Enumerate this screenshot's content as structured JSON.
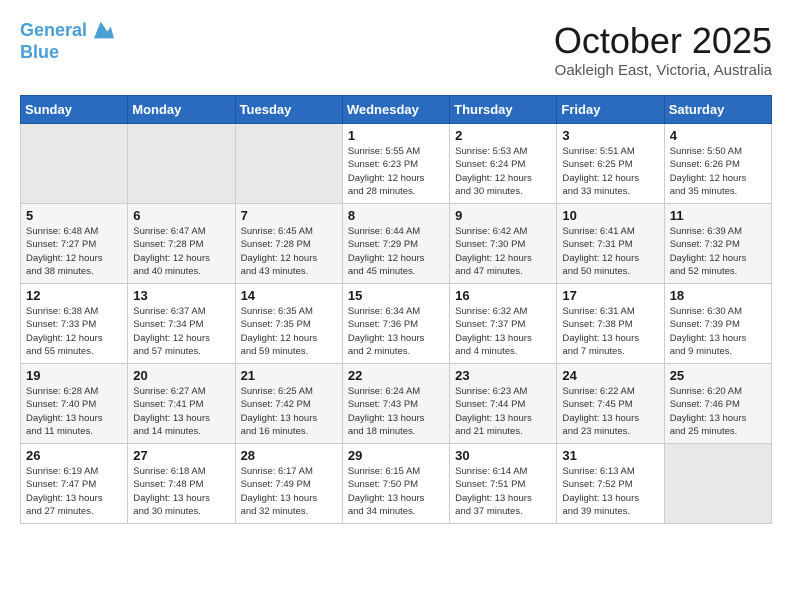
{
  "header": {
    "logo_line1": "General",
    "logo_line2": "Blue",
    "month": "October 2025",
    "location": "Oakleigh East, Victoria, Australia"
  },
  "weekdays": [
    "Sunday",
    "Monday",
    "Tuesday",
    "Wednesday",
    "Thursday",
    "Friday",
    "Saturday"
  ],
  "weeks": [
    [
      {
        "day": "",
        "info": ""
      },
      {
        "day": "",
        "info": ""
      },
      {
        "day": "",
        "info": ""
      },
      {
        "day": "1",
        "info": "Sunrise: 5:55 AM\nSunset: 6:23 PM\nDaylight: 12 hours\nand 28 minutes."
      },
      {
        "day": "2",
        "info": "Sunrise: 5:53 AM\nSunset: 6:24 PM\nDaylight: 12 hours\nand 30 minutes."
      },
      {
        "day": "3",
        "info": "Sunrise: 5:51 AM\nSunset: 6:25 PM\nDaylight: 12 hours\nand 33 minutes."
      },
      {
        "day": "4",
        "info": "Sunrise: 5:50 AM\nSunset: 6:26 PM\nDaylight: 12 hours\nand 35 minutes."
      }
    ],
    [
      {
        "day": "5",
        "info": "Sunrise: 6:48 AM\nSunset: 7:27 PM\nDaylight: 12 hours\nand 38 minutes."
      },
      {
        "day": "6",
        "info": "Sunrise: 6:47 AM\nSunset: 7:28 PM\nDaylight: 12 hours\nand 40 minutes."
      },
      {
        "day": "7",
        "info": "Sunrise: 6:45 AM\nSunset: 7:28 PM\nDaylight: 12 hours\nand 43 minutes."
      },
      {
        "day": "8",
        "info": "Sunrise: 6:44 AM\nSunset: 7:29 PM\nDaylight: 12 hours\nand 45 minutes."
      },
      {
        "day": "9",
        "info": "Sunrise: 6:42 AM\nSunset: 7:30 PM\nDaylight: 12 hours\nand 47 minutes."
      },
      {
        "day": "10",
        "info": "Sunrise: 6:41 AM\nSunset: 7:31 PM\nDaylight: 12 hours\nand 50 minutes."
      },
      {
        "day": "11",
        "info": "Sunrise: 6:39 AM\nSunset: 7:32 PM\nDaylight: 12 hours\nand 52 minutes."
      }
    ],
    [
      {
        "day": "12",
        "info": "Sunrise: 6:38 AM\nSunset: 7:33 PM\nDaylight: 12 hours\nand 55 minutes."
      },
      {
        "day": "13",
        "info": "Sunrise: 6:37 AM\nSunset: 7:34 PM\nDaylight: 12 hours\nand 57 minutes."
      },
      {
        "day": "14",
        "info": "Sunrise: 6:35 AM\nSunset: 7:35 PM\nDaylight: 12 hours\nand 59 minutes."
      },
      {
        "day": "15",
        "info": "Sunrise: 6:34 AM\nSunset: 7:36 PM\nDaylight: 13 hours\nand 2 minutes."
      },
      {
        "day": "16",
        "info": "Sunrise: 6:32 AM\nSunset: 7:37 PM\nDaylight: 13 hours\nand 4 minutes."
      },
      {
        "day": "17",
        "info": "Sunrise: 6:31 AM\nSunset: 7:38 PM\nDaylight: 13 hours\nand 7 minutes."
      },
      {
        "day": "18",
        "info": "Sunrise: 6:30 AM\nSunset: 7:39 PM\nDaylight: 13 hours\nand 9 minutes."
      }
    ],
    [
      {
        "day": "19",
        "info": "Sunrise: 6:28 AM\nSunset: 7:40 PM\nDaylight: 13 hours\nand 11 minutes."
      },
      {
        "day": "20",
        "info": "Sunrise: 6:27 AM\nSunset: 7:41 PM\nDaylight: 13 hours\nand 14 minutes."
      },
      {
        "day": "21",
        "info": "Sunrise: 6:25 AM\nSunset: 7:42 PM\nDaylight: 13 hours\nand 16 minutes."
      },
      {
        "day": "22",
        "info": "Sunrise: 6:24 AM\nSunset: 7:43 PM\nDaylight: 13 hours\nand 18 minutes."
      },
      {
        "day": "23",
        "info": "Sunrise: 6:23 AM\nSunset: 7:44 PM\nDaylight: 13 hours\nand 21 minutes."
      },
      {
        "day": "24",
        "info": "Sunrise: 6:22 AM\nSunset: 7:45 PM\nDaylight: 13 hours\nand 23 minutes."
      },
      {
        "day": "25",
        "info": "Sunrise: 6:20 AM\nSunset: 7:46 PM\nDaylight: 13 hours\nand 25 minutes."
      }
    ],
    [
      {
        "day": "26",
        "info": "Sunrise: 6:19 AM\nSunset: 7:47 PM\nDaylight: 13 hours\nand 27 minutes."
      },
      {
        "day": "27",
        "info": "Sunrise: 6:18 AM\nSunset: 7:48 PM\nDaylight: 13 hours\nand 30 minutes."
      },
      {
        "day": "28",
        "info": "Sunrise: 6:17 AM\nSunset: 7:49 PM\nDaylight: 13 hours\nand 32 minutes."
      },
      {
        "day": "29",
        "info": "Sunrise: 6:15 AM\nSunset: 7:50 PM\nDaylight: 13 hours\nand 34 minutes."
      },
      {
        "day": "30",
        "info": "Sunrise: 6:14 AM\nSunset: 7:51 PM\nDaylight: 13 hours\nand 37 minutes."
      },
      {
        "day": "31",
        "info": "Sunrise: 6:13 AM\nSunset: 7:52 PM\nDaylight: 13 hours\nand 39 minutes."
      },
      {
        "day": "",
        "info": ""
      }
    ]
  ]
}
